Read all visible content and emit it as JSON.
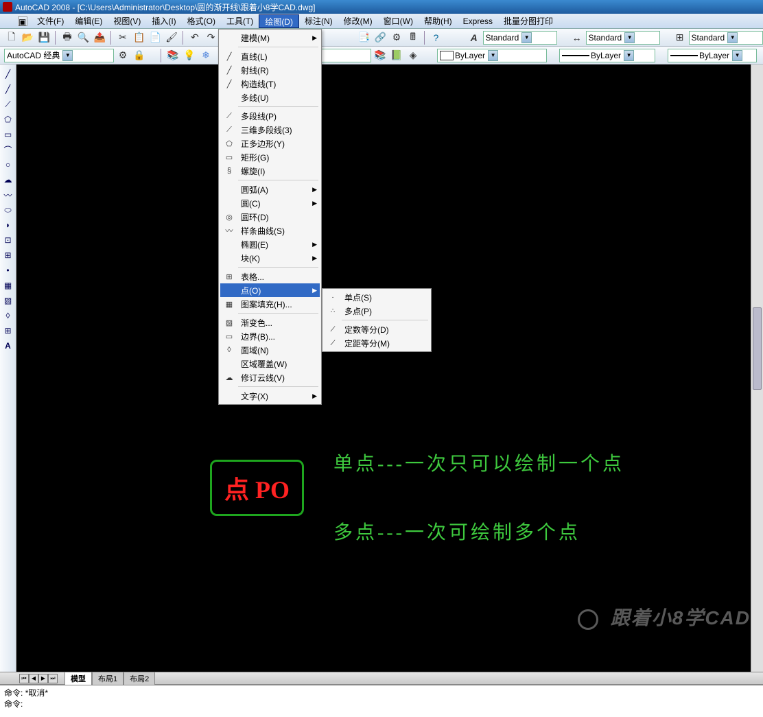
{
  "title": "AutoCAD 2008 - [C:\\Users\\Administrator\\Desktop\\圆的渐开线\\跟着小8学CAD.dwg]",
  "menubar": {
    "items": [
      "文件(F)",
      "编辑(E)",
      "视图(V)",
      "插入(I)",
      "格式(O)",
      "工具(T)",
      "绘图(D)",
      "标注(N)",
      "修改(M)",
      "窗口(W)",
      "帮助(H)",
      "Express",
      "批量分图打印"
    ]
  },
  "toolbar1": {
    "workspace": "AutoCAD 经典"
  },
  "style_row": {
    "style1": "Standard",
    "style2": "Standard",
    "style3": "Standard"
  },
  "layer_row": {
    "bylayer1": "ByLayer",
    "bylayer2": "ByLayer",
    "bylayer3": "ByLayer"
  },
  "draw_menu": {
    "modeling": "建模(M)",
    "line": "直线(L)",
    "ray": "射线(R)",
    "xline": "构造线(T)",
    "mline": "多线(U)",
    "pline": "多段线(P)",
    "pline3d": "三维多段线(3)",
    "polygon": "正多边形(Y)",
    "rect": "矩形(G)",
    "helix": "螺旋(I)",
    "arc": "圆弧(A)",
    "circle": "圆(C)",
    "donut": "圆环(D)",
    "spline": "样条曲线(S)",
    "ellipse": "椭圆(E)",
    "block": "块(K)",
    "table": "表格...",
    "point": "点(O)",
    "hatch": "图案填充(H)...",
    "gradient": "渐变色...",
    "boundary": "边界(B)...",
    "region": "面域(N)",
    "wipeout": "区域覆盖(W)",
    "revcloud": "修订云线(V)",
    "text": "文字(X)"
  },
  "point_submenu": {
    "single": "单点(S)",
    "multi": "多点(P)",
    "divide": "定数等分(D)",
    "measure": "定距等分(M)"
  },
  "tabs": {
    "t1": "模型",
    "t2": "布局1",
    "t3": "布局2"
  },
  "command": {
    "line1_label": "命令:",
    "line1_text": "*取消*",
    "line2_label": "命令:"
  },
  "annotation": {
    "box": "点 PO",
    "line1": "单点---一次只可以绘制一个点",
    "line2": "多点---一次可绘制多个点"
  },
  "watermark": "跟着小8学CAD"
}
